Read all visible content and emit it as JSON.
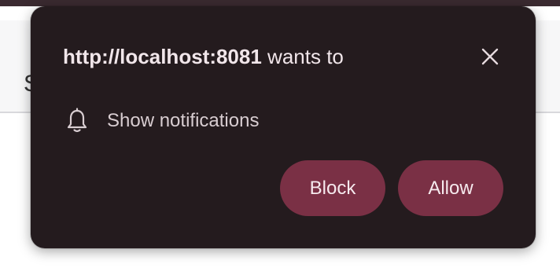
{
  "popup": {
    "origin": "http://localhost:8081",
    "request_suffix": " wants to",
    "permission_icon": "bell-icon",
    "permission_label": "Show notifications",
    "close_icon": "close-icon",
    "block_label": "Block",
    "allow_label": "Allow"
  },
  "underlay": {
    "partial_text": "S"
  },
  "colors": {
    "popup_bg": "#241b1e",
    "button_bg": "#7a3045",
    "text": "#f1e6ea"
  }
}
